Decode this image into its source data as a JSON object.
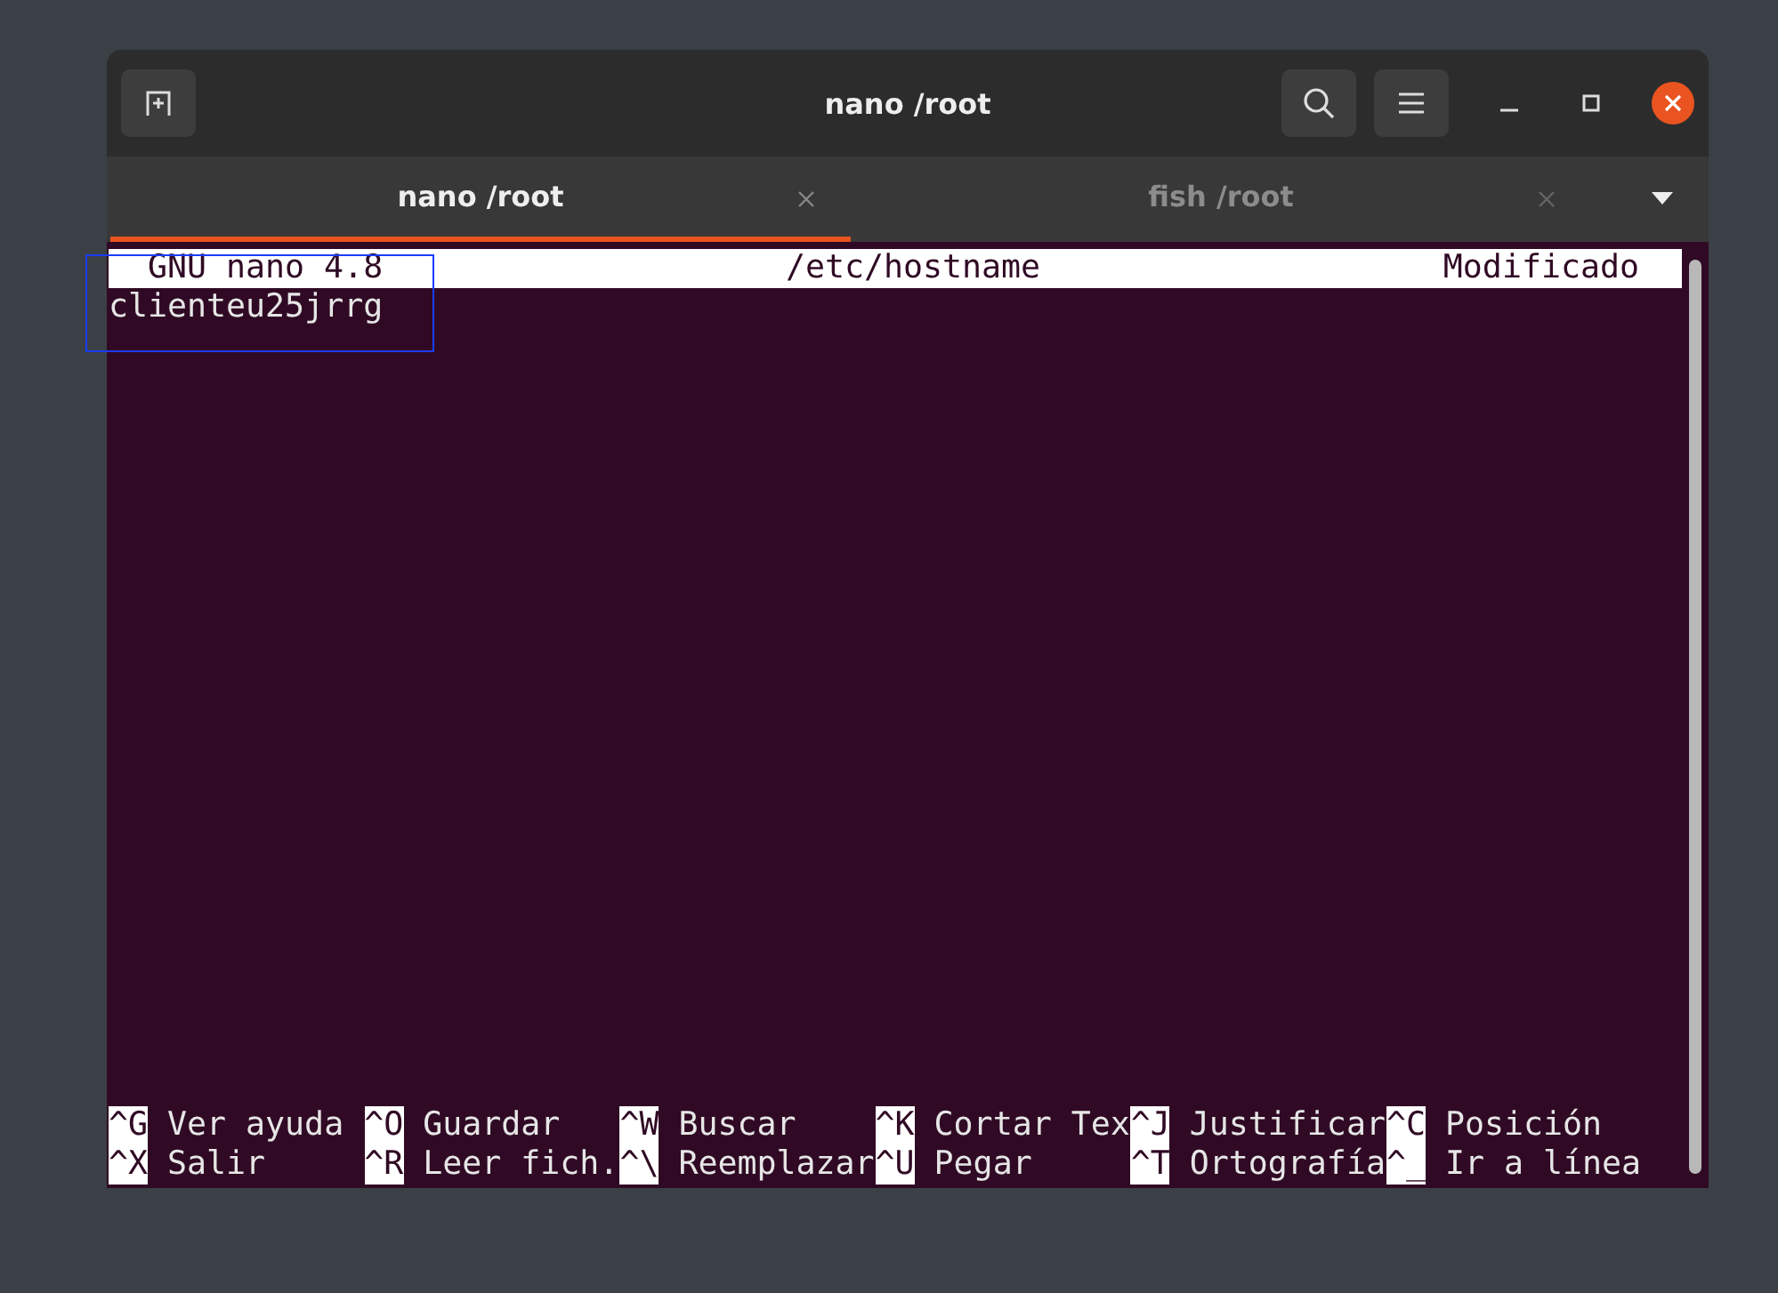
{
  "window": {
    "title": "nano /root"
  },
  "tabs": [
    {
      "label": "nano /root",
      "selected": true
    },
    {
      "label": "fish /root",
      "selected": false
    }
  ],
  "nano": {
    "version": "GNU nano 4.8",
    "file": "/etc/hostname",
    "status": "Modificado",
    "lines": [
      "clienteu25jrrg"
    ],
    "shortcuts": [
      [
        {
          "key": "^G",
          "label": "Ver ayuda"
        },
        {
          "key": "^O",
          "label": "Guardar"
        },
        {
          "key": "^W",
          "label": "Buscar"
        },
        {
          "key": "^K",
          "label": "Cortar Tex"
        },
        {
          "key": "^J",
          "label": "Justificar"
        },
        {
          "key": "^C",
          "label": "Posición"
        }
      ],
      [
        {
          "key": "^X",
          "label": "Salir"
        },
        {
          "key": "^R",
          "label": "Leer fich."
        },
        {
          "key": "^\\",
          "label": "Reemplazar"
        },
        {
          "key": "^U",
          "label": "Pegar"
        },
        {
          "key": "^T",
          "label": "Ortografía"
        },
        {
          "key": "^_",
          "label": "Ir a línea"
        }
      ]
    ]
  }
}
